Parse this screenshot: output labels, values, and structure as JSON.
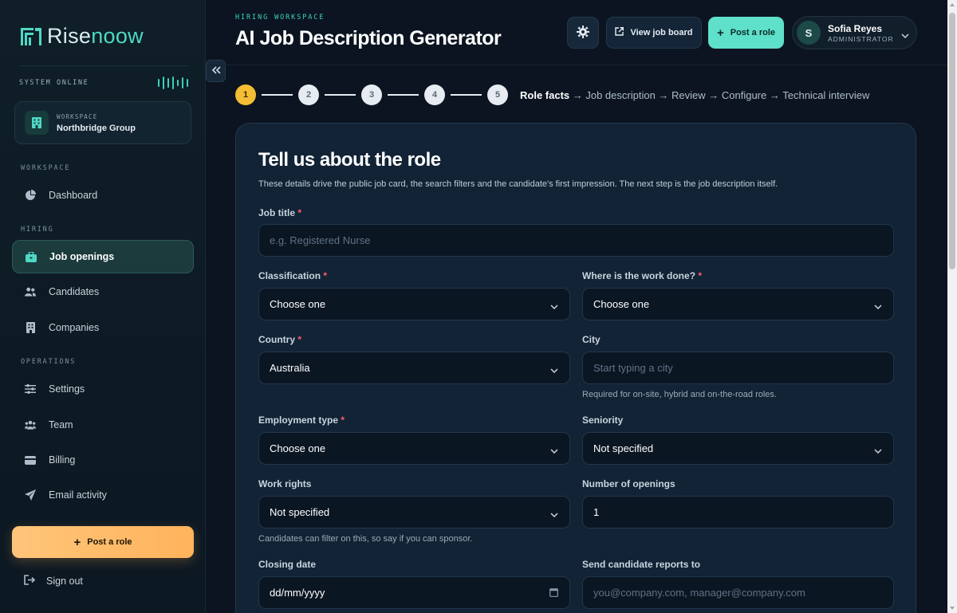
{
  "brand": {
    "name_part1": "Rise",
    "name_part2": "noow",
    "logo_icon": "rn-logo-icon"
  },
  "system_status": {
    "label": "SYSTEM ONLINE",
    "icon": "signal-wave-icon"
  },
  "workspace": {
    "label": "WORKSPACE",
    "name": "Northbridge Group",
    "icon": "building-icon"
  },
  "sidebar": {
    "sections": {
      "workspace": "WORKSPACE",
      "hiring": "HIRING",
      "operations": "OPERATIONS"
    },
    "items": [
      {
        "label": "Dashboard",
        "icon": "pie-chart-icon",
        "active": false
      },
      {
        "label": "Job openings",
        "icon": "briefcase-icon",
        "active": true
      },
      {
        "label": "Candidates",
        "icon": "users-icon",
        "active": false
      },
      {
        "label": "Companies",
        "icon": "building-icon",
        "active": false
      },
      {
        "label": "Settings",
        "icon": "sliders-icon",
        "active": false
      },
      {
        "label": "Team",
        "icon": "team-icon",
        "active": false
      },
      {
        "label": "Billing",
        "icon": "credit-card-icon",
        "active": false
      },
      {
        "label": "Email activity",
        "icon": "paper-plane-icon",
        "active": false
      }
    ],
    "post_role_label": "Post a role",
    "sign_out_label": "Sign out"
  },
  "header": {
    "eyebrow": "HIRING WORKSPACE",
    "title": "AI Job Description Generator",
    "view_job_board_label": "View job board",
    "post_role_label": "Post a role",
    "user": {
      "initial": "S",
      "name": "Sofia Reyes",
      "role": "ADMINISTRATOR"
    }
  },
  "stepper": {
    "steps": [
      "1",
      "2",
      "3",
      "4",
      "5"
    ],
    "current_step": 1,
    "crumb_current": "Role facts",
    "crumb_rest": " → Job description → Review → Configure → Technical interview"
  },
  "form": {
    "title": "Tell us about the role",
    "subtitle": "These details drive the public job card, the search filters and the candidate's first impression. The next step is the job description itself.",
    "job_title": {
      "label": "Job title",
      "placeholder": "e.g. Registered Nurse",
      "value": ""
    },
    "classification": {
      "label": "Classification",
      "value": "Choose one"
    },
    "work_location": {
      "label": "Where is the work done?",
      "value": "Choose one"
    },
    "country": {
      "label": "Country",
      "value": "Australia"
    },
    "city": {
      "label": "City",
      "placeholder": "Start typing a city",
      "hint": "Required for on-site, hybrid and on-the-road roles."
    },
    "employment_type": {
      "label": "Employment type",
      "value": "Choose one"
    },
    "seniority": {
      "label": "Seniority",
      "value": "Not specified"
    },
    "work_rights": {
      "label": "Work rights",
      "value": "Not specified",
      "hint": "Candidates can filter on this, so say if you can sponsor."
    },
    "openings": {
      "label": "Number of openings",
      "value": "1"
    },
    "closing_date": {
      "label": "Closing date",
      "placeholder": "dd/mm/yyyy"
    },
    "reports_to": {
      "label": "Send candidate reports to",
      "placeholder": "you@company.com, manager@company.com"
    },
    "required_mark": "*"
  },
  "colors": {
    "accent": "#5ee0cb",
    "warning": "#f4bd34",
    "cta": "#ffb35c",
    "required": "#ff5d6c"
  }
}
